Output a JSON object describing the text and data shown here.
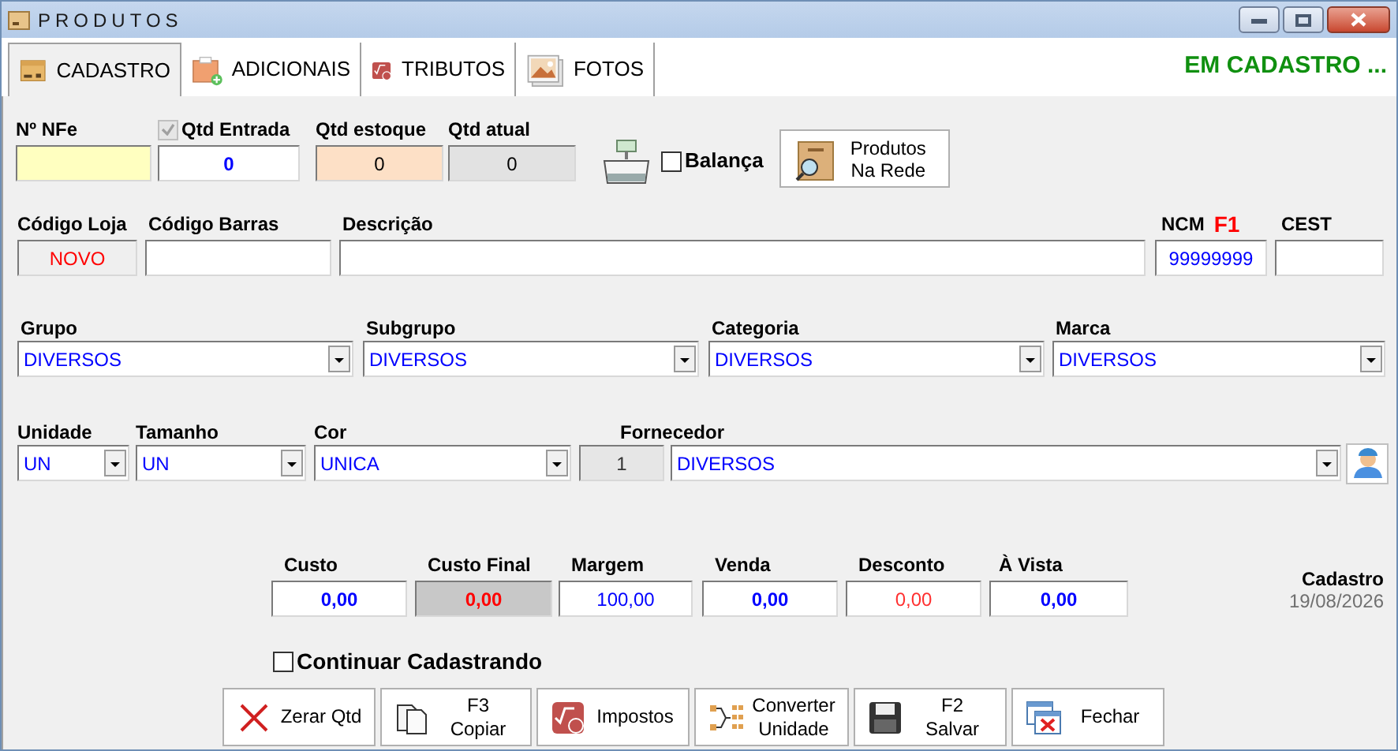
{
  "window": {
    "title": "PRODUTOS"
  },
  "tabs": [
    {
      "label": "CADASTRO",
      "selected": true
    },
    {
      "label": "ADICIONAIS",
      "selected": false
    },
    {
      "label": "TRIBUTOS",
      "selected": false
    },
    {
      "label": "FOTOS",
      "selected": false
    }
  ],
  "mode_status": "EM CADASTRO ...",
  "stock_row": {
    "nfe": {
      "label": "Nº NFe"
    },
    "qtd_entrada": {
      "label": "Qtd Entrada",
      "checked": true,
      "disabled": true,
      "value": "0"
    },
    "qtd_estoque": {
      "label": "Qtd estoque",
      "value": "0"
    },
    "qtd_atual": {
      "label": "Qtd atual",
      "value": "0"
    },
    "balanca": {
      "label": "Balança",
      "checked": false
    },
    "network_button": {
      "lines": [
        "Produtos",
        "Na Rede"
      ]
    }
  },
  "identity_row": [
    {
      "label": "Código Loja",
      "value": "NOVO"
    },
    {
      "label": "Código Barras"
    },
    {
      "label": "Descrição"
    },
    {
      "label": "NCM",
      "hint": "F1",
      "value": "99999999"
    },
    {
      "label": "CEST"
    }
  ],
  "classification_row": [
    {
      "label": "Grupo",
      "value": "DIVERSOS"
    },
    {
      "label": "Subgrupo",
      "value": "DIVERSOS"
    },
    {
      "label": "Categoria",
      "value": "DIVERSOS"
    },
    {
      "label": "Marca",
      "value": "DIVERSOS"
    }
  ],
  "details_row": {
    "unidade": {
      "label": "Unidade",
      "value": "UN"
    },
    "tamanho": {
      "label": "Tamanho",
      "value": "UN"
    },
    "cor": {
      "label": "Cor",
      "value": "UNICA"
    },
    "fornecedor": {
      "label": "Fornecedor",
      "code": "1",
      "value": "DIVERSOS"
    }
  },
  "prices": [
    {
      "label": "Custo",
      "value": "0,00"
    },
    {
      "label": "Custo Final",
      "value": "0,00"
    },
    {
      "label": "Margem",
      "value": "100,00"
    },
    {
      "label": "Venda",
      "value": "0,00"
    },
    {
      "label": "Desconto",
      "value": "0,00"
    },
    {
      "label": "À Vista",
      "value": "0,00"
    }
  ],
  "cadastro": {
    "label": "Cadastro",
    "date": "19/08/2026"
  },
  "continuar": {
    "label": "Continuar Cadastrando",
    "checked": false
  },
  "buttons": [
    {
      "lines": [
        "Zerar Qtd"
      ]
    },
    {
      "lines": [
        "F3",
        "Copiar"
      ]
    },
    {
      "lines": [
        "Impostos"
      ]
    },
    {
      "lines": [
        "Converter",
        "Unidade"
      ]
    },
    {
      "lines": [
        "F2",
        "Salvar"
      ]
    },
    {
      "lines": [
        "Fechar"
      ]
    }
  ]
}
